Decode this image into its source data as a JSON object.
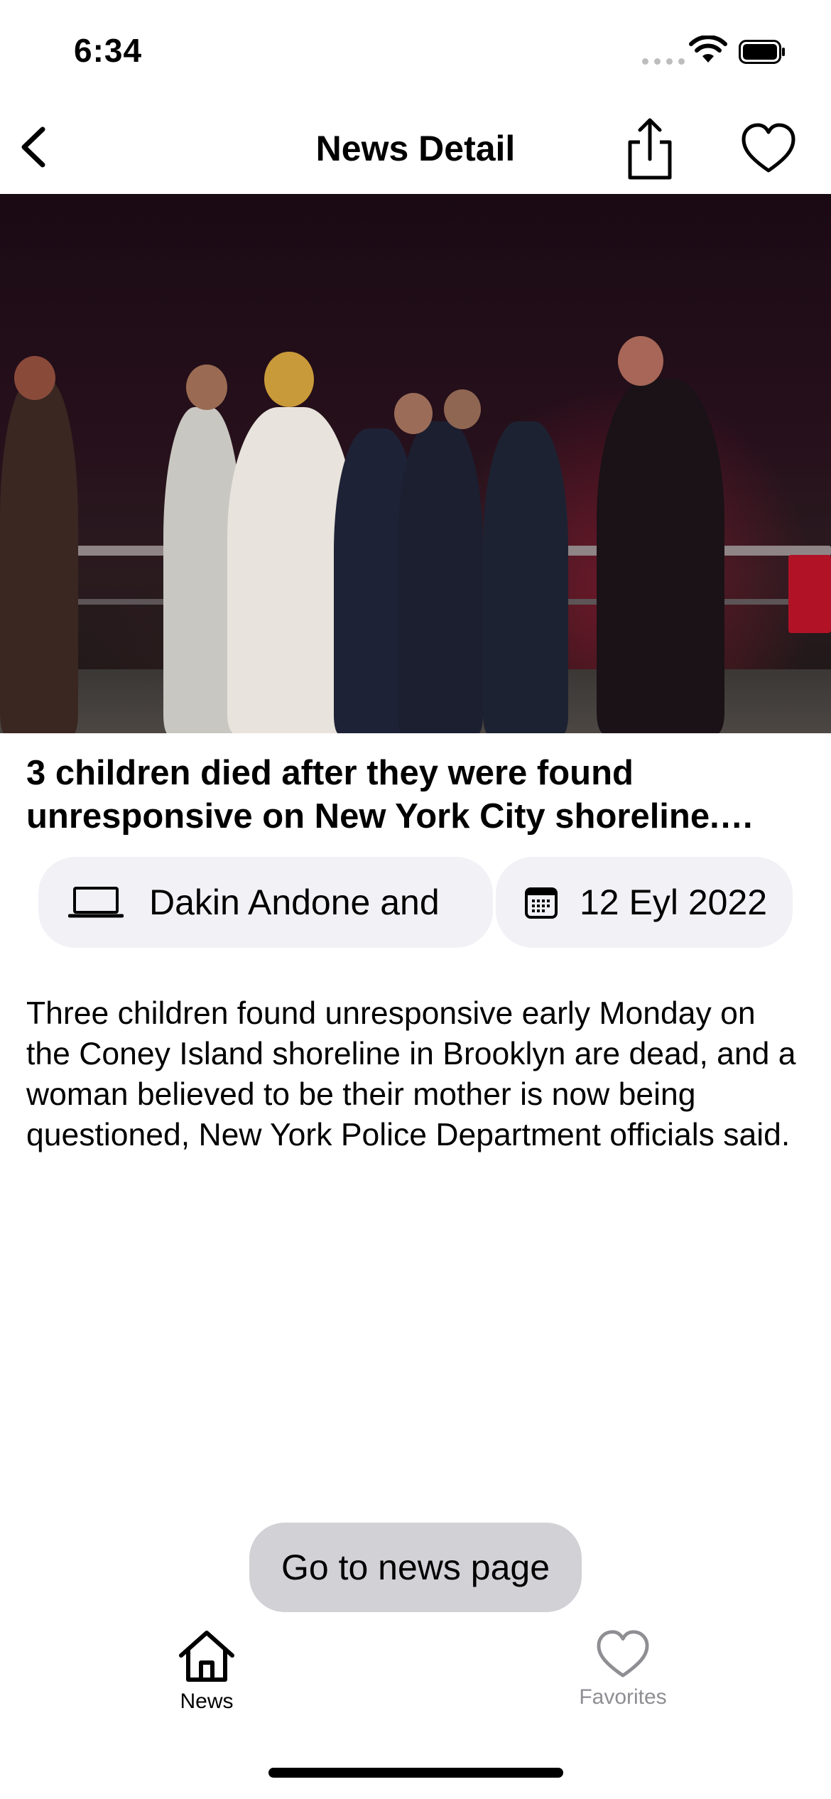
{
  "status_bar": {
    "time": "6:34",
    "icons": [
      "cellular-signal-icon",
      "wifi-icon",
      "battery-icon"
    ]
  },
  "nav": {
    "title": "News Detail",
    "icons": [
      "back-chevron-icon",
      "share-icon",
      "heart-outline-icon"
    ]
  },
  "article": {
    "headline": "3 children died after they were found unresponsive on New York City shoreline. Police are questioning a woman believed to be their mother",
    "author": "Dakin Andone and",
    "date": "12 Eyl 2022",
    "body": "Three children found unresponsive early Monday on the Coney Island shoreline in Brooklyn are dead, and a woman believed to be their mother is now being questioned, New York Police Department officials said.",
    "author_icon": "laptop-icon",
    "date_icon": "calendar-icon"
  },
  "actions": {
    "go_to_news": "Go to news page"
  },
  "tab_bar": {
    "tabs": [
      {
        "label": "News",
        "icon": "house-icon",
        "selected": true
      },
      {
        "label": "Favorites",
        "icon": "heart-outline-icon",
        "selected": false
      }
    ]
  },
  "colors": {
    "chip_background": "#f1f1f6",
    "button_background": "#d1d1d6",
    "inactive_tab": "#8e8e93"
  }
}
